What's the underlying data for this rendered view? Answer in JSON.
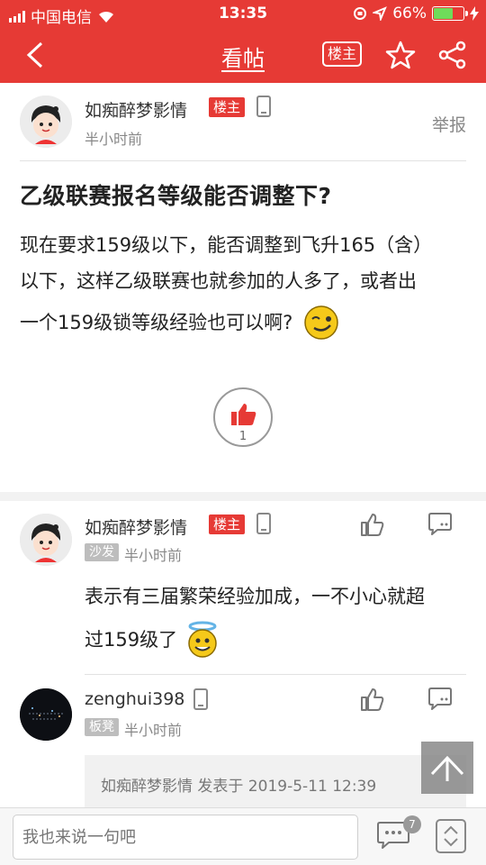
{
  "status_bar": {
    "carrier": "中国电信",
    "time": "13:35",
    "battery": "66%",
    "battery_level": 0.66
  },
  "nav": {
    "title": "看帖",
    "owner_label": "楼主"
  },
  "post": {
    "author": "如痴醉梦影情",
    "owner_tag": "楼主",
    "time": "半小时前",
    "report": "举报",
    "title": "乙级联赛报名等级能否调整下?",
    "body_line1": "现在要求159级以下，能否调整到飞升165（含）",
    "body_line2": "以下，这样乙级联赛也就参加的人多了，或者出",
    "body_line3": "一个159级锁等级经验也可以啊?",
    "like_count": "1"
  },
  "replies": [
    {
      "author": "如痴醉梦影情",
      "owner_tag": "楼主",
      "floor": "沙发",
      "time": "半小时前",
      "line1": "表示有三届繁荣经验加成，一不小心就超",
      "line2": "过159级了"
    },
    {
      "author": "zenghui398",
      "floor": "板凳",
      "time": "半小时前",
      "quote": "如痴醉梦影情 发表于 2019-5-11 12:39"
    }
  ],
  "bottom": {
    "placeholder": "我也来说一句吧",
    "comment_count": "7"
  },
  "colors": {
    "brand": "#e63a35"
  }
}
